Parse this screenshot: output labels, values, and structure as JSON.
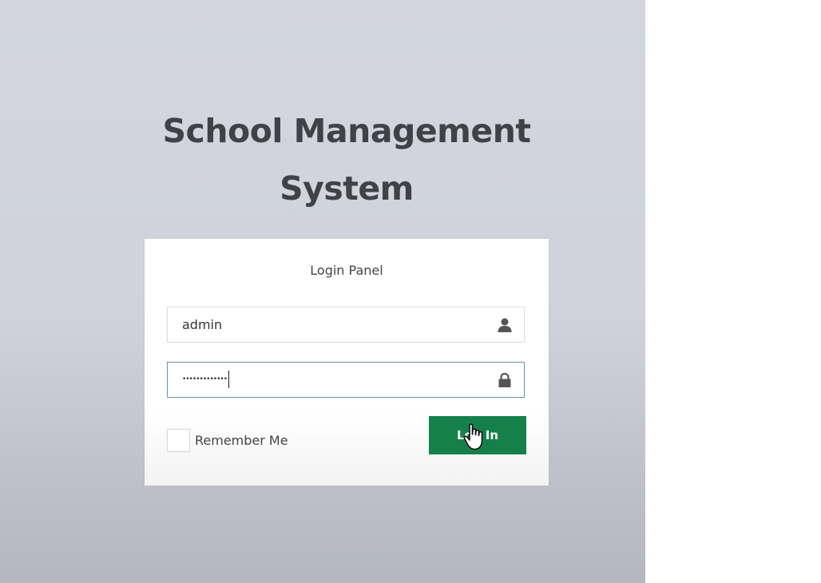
{
  "page": {
    "title_line1": "School Management",
    "title_line2": "System"
  },
  "login_panel": {
    "heading": "Login Panel",
    "username_value": "admin",
    "password_value": "•••••••••••••",
    "remember_label": "Remember Me",
    "submit_label": "Log In",
    "user_icon": "user-icon",
    "lock_icon": "lock-icon"
  },
  "colors": {
    "button_bg": "#16804a",
    "title": "#3f4246",
    "background": "#d0d3dc"
  }
}
